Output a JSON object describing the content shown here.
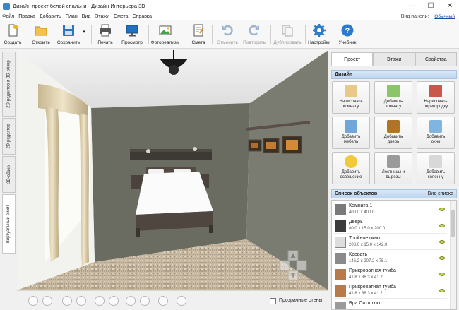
{
  "window": {
    "title": "Дизайн проект белой спальни - Дизайн Интерьера 3D",
    "minimize_glyph": "—",
    "maximize_glyph": "☐",
    "close_glyph": "✕"
  },
  "menu": {
    "items": [
      "Файл",
      "Правка",
      "Добавить",
      "План",
      "Вид",
      "Этажи",
      "Смета",
      "Справка"
    ],
    "right_prefix": "Вид панели:",
    "right_value": "Обычный"
  },
  "toolbar": {
    "create": "Создать",
    "open": "Открыть",
    "save": "Сохранить",
    "save_arrow": "▾",
    "print": "Печать",
    "preview": "Просмотр",
    "photoreal": "Фотореализм",
    "estimate": "Смета",
    "undo": "Отменить",
    "redo": "Повторить",
    "duplicate": "Дублировать",
    "settings": "Настройки",
    "tutorial": "Учебник"
  },
  "left_tabs": [
    "2D-редактор и 3D-обзор",
    "2D-редактор",
    "3D-обзор",
    "Виртуальный визит"
  ],
  "viewbar": {
    "transparent_walls": "Прозрачные стены",
    "transparent_walls_checked": false
  },
  "right_panel": {
    "tabs": [
      "Проект",
      "Этажи",
      "Свойства"
    ],
    "design_heading": "Дизайн",
    "design_buttons": [
      "Нарисовать\nкомнату",
      "Добавить\nкомнату",
      "Нарисовать\nперегородку",
      "Добавить\nмебель",
      "Добавить\nдверь",
      "Добавить\nокно",
      "Добавить\nосвещение",
      "Лестницы и\nвырезы",
      "Добавить\nколонну"
    ],
    "objects_heading": "Список объектов",
    "objects_view_label": "Вид списка",
    "objects": [
      {
        "name": "Комната 1",
        "dims": "400.0 x 400.0"
      },
      {
        "name": "Дверь",
        "dims": "80.0 x 15.0 x 200.0"
      },
      {
        "name": "Тройное окно",
        "dims": "208.0 x 15.0 x 142.0"
      },
      {
        "name": "Кровать",
        "dims": "146.2 x 207.2 x 75.1"
      },
      {
        "name": "Прикроватная тумба",
        "dims": "41.8 x 36.3 x 41.2"
      },
      {
        "name": "Прикроватная тумба",
        "dims": "41.8 x 36.3 x 41.2"
      },
      {
        "name": "Бра Ситилюкс",
        "dims": ""
      }
    ]
  },
  "colors": {
    "accent": "#3a86c8",
    "section_head": "#c9ddf2",
    "wall": "#6b6d62",
    "floor": "#b8a890"
  }
}
